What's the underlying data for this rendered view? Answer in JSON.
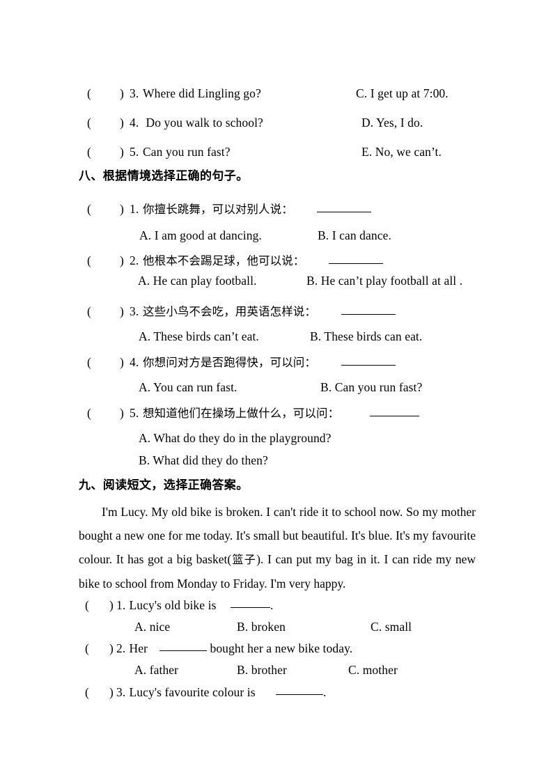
{
  "document": {
    "type": "worksheet",
    "language": "zh-en",
    "page_background": "#ffffff",
    "text_color": "#000000"
  },
  "matching_tail": {
    "items": [
      {
        "marker_open": "(",
        "marker_close": ")",
        "number": "3.",
        "question": "Where did Lingling go?",
        "answer_label": "C. I get up at 7:00."
      },
      {
        "marker_open": "(",
        "marker_close": ")",
        "number": "4.",
        "question": " Do you walk to school?",
        "answer_label": "D. Yes, I do."
      },
      {
        "marker_open": "(",
        "marker_close": ")",
        "number": "5.",
        "question": "Can you run fast?",
        "answer_label": "E. No, we can’t."
      }
    ]
  },
  "section_eight": {
    "heading": "八、根据情境选择正确的句子。",
    "items": [
      {
        "marker_open": "(",
        "marker_close": ")",
        "number": "1.",
        "stem": "你擅长跳舞，可以对别人说：",
        "option_a": "A. I am good at dancing.",
        "option_b": "B. I can dance."
      },
      {
        "marker_open": "(",
        "marker_close": ")",
        "number": "2.",
        "stem": "他根本不会踢足球，他可以说：",
        "option_a": "A. He can play football.",
        "option_b": "B. He can’t play football at all ."
      },
      {
        "marker_open": "(",
        "marker_close": ")",
        "number": "3.",
        "stem": "这些小鸟不会吃，用英语怎样说：",
        "option_a": "A. These birds can’t eat.",
        "option_b": "B. These birds can eat."
      },
      {
        "marker_open": "(",
        "marker_close": ")",
        "number": "4.",
        "stem": "你想问对方是否跑得快，可以问：",
        "option_a": "A. You can run fast.",
        "option_b": "B. Can you run fast?"
      },
      {
        "marker_open": "(",
        "marker_close": ")",
        "number": "5.",
        "stem": "想知道他们在操场上做什么，可以问：",
        "option_a": "A. What do they do in the playground?",
        "option_b": "B. What did they do then?"
      }
    ]
  },
  "section_nine": {
    "heading": "九、阅读短文，选择正确答案。",
    "passage_part1": "I'm Lucy. My old bike is broken. I can't ride it to school now. So my mother bought a new one for me today. It's small but beautiful. It's blue. It's my favourite colour. It has got a big basket(",
    "passage_gloss": "篮子",
    "passage_part2": "). I can put my bag in it. I can ride my new bike to school from Monday to Friday. I'm very happy.",
    "questions": [
      {
        "marker_open": "(",
        "marker_close": ")",
        "number": "1.",
        "stem_before": " Lucy's old bike is ",
        "stem_after": ".",
        "option_a": "A. nice",
        "option_b": "B. broken",
        "option_c": "C. small"
      },
      {
        "marker_open": "(",
        "marker_close": ")",
        "number": "2.",
        "stem_before": " Her ",
        "stem_after": " bought her a new bike today.",
        "option_a": "A. father",
        "option_b": "B. brother",
        "option_c": "C. mother"
      },
      {
        "marker_open": "(",
        "marker_close": ")",
        "number": "3.",
        "stem_before": " Lucy's favourite colour is ",
        "stem_after": ".",
        "option_a": "",
        "option_b": "",
        "option_c": ""
      }
    ]
  }
}
